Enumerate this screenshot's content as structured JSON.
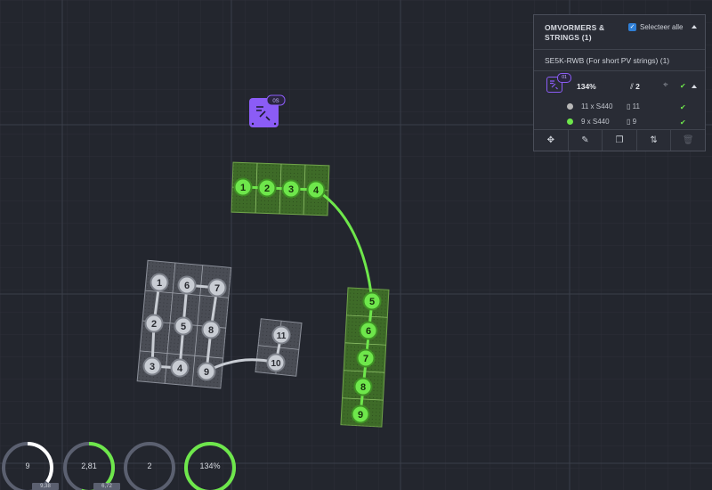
{
  "panel": {
    "title_line1": "OMVORMERS &",
    "title_line2": "STRINGS (1)",
    "select_all": "Selecteer alle",
    "inverter": {
      "name": "SE5K-RWB (For short PV strings) (1)",
      "badge": "01",
      "percent": "134%",
      "strings_label": "2",
      "modules": [
        {
          "label": "11 x S440",
          "count": "11",
          "color": "#b8b8b8"
        },
        {
          "label": "9 x S440",
          "count": "9",
          "color": "#6ee74b"
        }
      ]
    },
    "toolbar_icons": [
      "move-icon",
      "pencil-icon",
      "copy-icon",
      "string-icon",
      "trash-icon"
    ]
  },
  "canvas_inverter_badge": "0S",
  "strings": {
    "green": [
      "1",
      "2",
      "3",
      "4",
      "5",
      "6",
      "7",
      "8",
      "9"
    ],
    "gray": [
      "1",
      "2",
      "3",
      "4",
      "5",
      "6",
      "7",
      "8",
      "9",
      "10",
      "11"
    ]
  },
  "gauges": [
    {
      "value": "9",
      "fill": 0.35,
      "color": "#ffffff",
      "tab": "9,38"
    },
    {
      "value": "2,81",
      "fill": 0.55,
      "color": "#6ee74b",
      "tab": "6,72"
    },
    {
      "value": "2",
      "fill": 0.0,
      "color": "#9aa0ab",
      "tab": ""
    },
    {
      "value": "134%",
      "fill": 1.0,
      "color": "#6ee74b",
      "tab": ""
    }
  ],
  "colors": {
    "accent_green": "#6ee74b",
    "inverter_purple": "#8b5cf6",
    "background": "#23262e"
  }
}
